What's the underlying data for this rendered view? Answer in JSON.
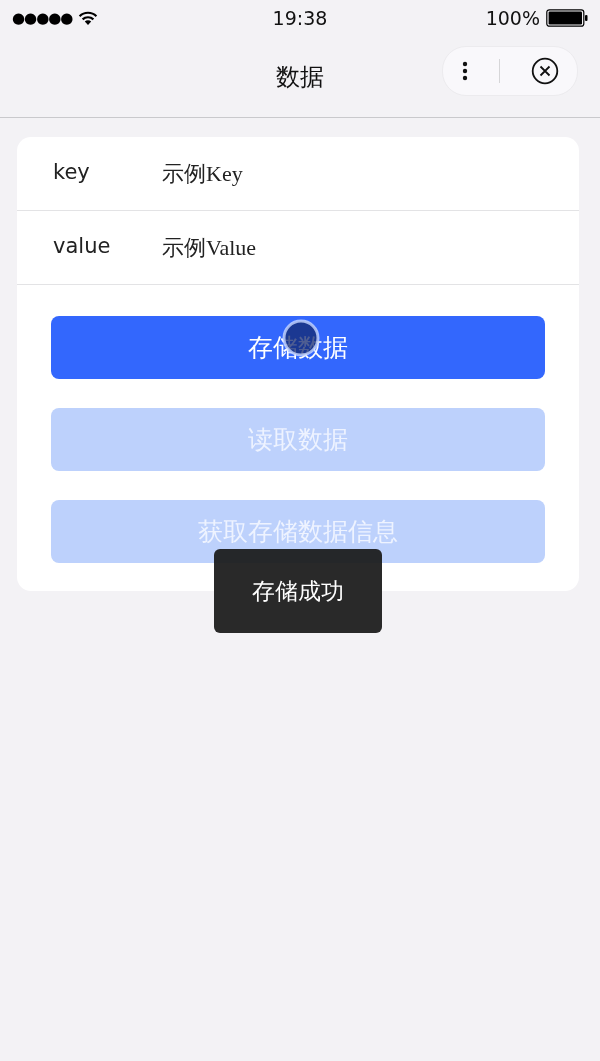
{
  "status_bar": {
    "signal_dots": "●●●●●",
    "time": "19:38",
    "battery": "100%"
  },
  "nav_bar": {
    "title": "数据"
  },
  "form": {
    "fields": [
      {
        "label": "key",
        "value": "示例Key"
      },
      {
        "label": "value",
        "value": "示例Value"
      }
    ],
    "buttons": [
      {
        "label": "存储数据",
        "disabled": false,
        "pressed": true
      },
      {
        "label": "读取数据",
        "disabled": true,
        "pressed": false
      },
      {
        "label": "获取存储数据信息",
        "disabled": true,
        "pressed": false
      }
    ]
  },
  "toast": {
    "text": "存储成功"
  }
}
